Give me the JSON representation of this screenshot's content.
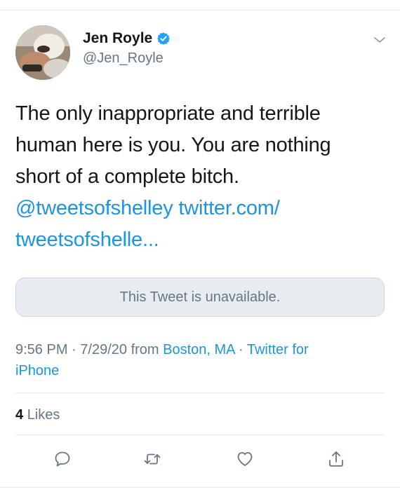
{
  "tweet": {
    "author": {
      "display_name": "Jen Royle",
      "handle": "@Jen_Royle",
      "verified": true
    },
    "text": {
      "line1": "The only inappropriate and terrible",
      "line2": "human here is you. You are nothing",
      "line3": "short of a complete bitch.",
      "mention": "@tweetsofshelley",
      "url_part1": "twitter.com/",
      "url_part2": "tweetsofshelle..."
    },
    "quoted_status": "This Tweet is unavailable.",
    "meta": {
      "time": "9:56 PM",
      "date": "7/29/20",
      "from_label": "from",
      "location": "Boston, MA",
      "separator": "·",
      "client_part1": "Twitter for",
      "client_part2": "iPhone"
    },
    "likes": {
      "count": "4",
      "label": "Likes"
    },
    "icons": {
      "verified": "verified-badge-icon",
      "menu": "chevron-down-icon",
      "reply": "reply-icon",
      "retweet": "retweet-icon",
      "like": "heart-icon",
      "share": "share-icon"
    },
    "colors": {
      "link": "#1b95e0",
      "secondary_text": "#657786",
      "primary_text": "#14171a",
      "verified": "#1da1f2"
    }
  }
}
